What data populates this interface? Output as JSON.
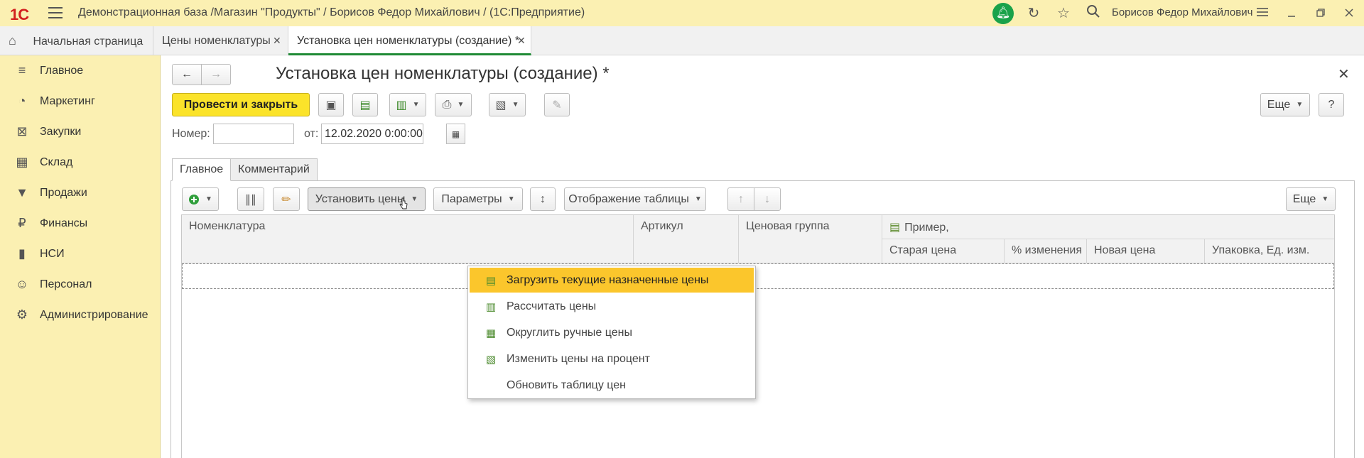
{
  "titlebar": {
    "logo": "1С",
    "title": "Демонстрационная база /Магазин \"Продукты\" / Борисов Федор Михайлович /  (1С:Предприятие)",
    "user": "Борисов Федор Михайлович"
  },
  "tabs": [
    {
      "label": "Начальная страница"
    },
    {
      "label": "Цены номенклатуры"
    },
    {
      "label": "Установка цен номенклатуры (создание) *"
    }
  ],
  "sidebar": {
    "items": [
      {
        "label": "Главное",
        "icon": "menu-lines-icon"
      },
      {
        "label": "Маркетинг",
        "icon": "pie-chart-icon"
      },
      {
        "label": "Закупки",
        "icon": "cart-icon"
      },
      {
        "label": "Склад",
        "icon": "warehouse-icon"
      },
      {
        "label": "Продажи",
        "icon": "basket-icon"
      },
      {
        "label": "Финансы",
        "icon": "ruble-coin-icon"
      },
      {
        "label": "НСИ",
        "icon": "book-icon"
      },
      {
        "label": "Персонал",
        "icon": "person-icon"
      },
      {
        "label": "Администрирование",
        "icon": "gear-icon"
      }
    ]
  },
  "form": {
    "title": "Установка цен номенклатуры (создание) *",
    "post_close_label": "Провести и закрыть",
    "more_label": "Еще",
    "help_label": "?",
    "number_label": "Номер:",
    "number_value": "",
    "date_label": "от:",
    "date_value": "12.02.2020  0:00:00",
    "form_tabs": [
      "Главное",
      "Комментарий"
    ],
    "set_prices_label": "Установить цены",
    "parameters_label": "Параметры",
    "table_display_label": "Отображение таблицы",
    "more2_label": "Еще"
  },
  "grid": {
    "headers": {
      "nomenclature": "Номенклатура",
      "article": "Артикул",
      "price_group": "Ценовая группа",
      "example": "Пример,",
      "old_price": "Старая цена",
      "change_pct": "% изменения",
      "new_price": "Новая цена",
      "package": "Упаковка, Ед. изм."
    }
  },
  "menu": {
    "items": [
      {
        "label": "Загрузить текущие назначенные цены",
        "highlighted": true
      },
      {
        "label": "Рассчитать цены",
        "highlighted": false
      },
      {
        "label": "Округлить ручные цены",
        "highlighted": false
      },
      {
        "label": "Изменить цены на процент",
        "highlighted": false
      },
      {
        "label": "Обновить таблицу цен",
        "highlighted": false
      }
    ]
  },
  "colors": {
    "accent_yellow": "#fbe32a",
    "sidebar_bg": "#fbf0b2",
    "menu_highlight": "#fbc62c",
    "active_tab_underline": "#1e8a35",
    "bell_green": "#1aa24a"
  }
}
